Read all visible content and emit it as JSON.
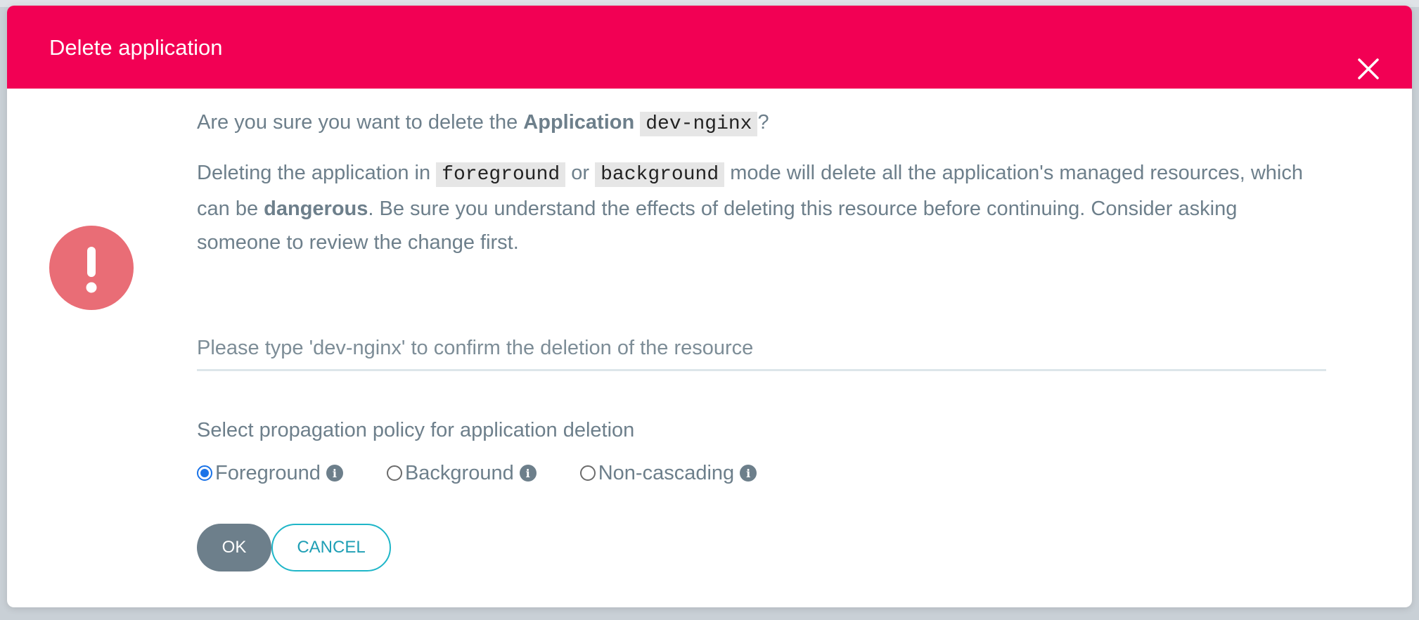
{
  "dialog": {
    "title": "Delete application",
    "close_icon": "close-icon",
    "alert_icon": "exclamation-circle-icon",
    "header_color": "#f20054",
    "alert_color": "#e96d76"
  },
  "question": {
    "prefix": "Are you sure you want to delete the ",
    "bold": "Application",
    "app_name": "dev-nginx",
    "suffix": "?"
  },
  "warning": {
    "part1": "Deleting the application in ",
    "code1": "foreground",
    "part2": " or ",
    "code2": "background",
    "part3": " mode will delete all the application's managed resources, which can be ",
    "bold": "dangerous",
    "part4": ". Be sure you understand the effects of deleting this resource before continuing. Consider asking someone to review the change first."
  },
  "confirm_input": {
    "value": "",
    "placeholder": "Please type 'dev-nginx' to confirm the deletion of the resource"
  },
  "policy": {
    "label": "Select propagation policy for application deletion",
    "selected": "Foreground",
    "options": [
      {
        "label": "Foreground",
        "checked": true
      },
      {
        "label": "Background",
        "checked": false
      },
      {
        "label": "Non-cascading",
        "checked": false
      }
    ],
    "info_icon": "info-icon"
  },
  "buttons": {
    "ok": "OK",
    "cancel": "CANCEL",
    "ok_color": "#6d7f8b",
    "cancel_color": "#1fb6c8"
  }
}
